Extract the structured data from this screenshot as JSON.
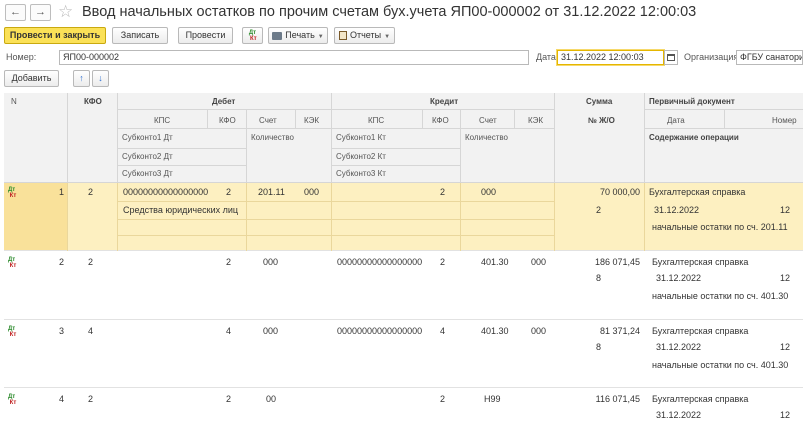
{
  "window": {
    "title": "Ввод начальных остатков по прочим счетам бух.учета ЯП00-000002 от 31.12.2022 12:00:03"
  },
  "toolbar": {
    "post_close": "Провести и закрыть",
    "save": "Записать",
    "post": "Провести",
    "print": "Печать",
    "reports": "Отчеты"
  },
  "form": {
    "number_label": "Номер:",
    "number_value": "ЯП00-000002",
    "date_label": "Дата:",
    "date_value": "31.12.2022 12:00:03",
    "org_label": "Организация:",
    "org_value": "ФГБУ санаторий"
  },
  "table_toolbar": {
    "add": "Добавить"
  },
  "columns": {
    "n": "N",
    "kfo": "КФО",
    "debit": "Дебет",
    "debit_kps": "КПС",
    "debit_kfo": "КФО",
    "debit_account": "Счет",
    "debit_kek": "КЭК",
    "debit_sub1": "Субконто1 Дт",
    "debit_sub2": "Субконто2 Дт",
    "debit_sub3": "Субконто3 Дт",
    "debit_qty": "Количество",
    "credit": "Кредит",
    "credit_kps": "КПС",
    "credit_kfo": "КФО",
    "credit_account": "Счет",
    "credit_kek": "КЭК",
    "credit_sub1": "Субконто1 Кт",
    "credit_sub2": "Субконто2 Кт",
    "credit_sub3": "Субконто3 Кт",
    "credit_qty": "Количество",
    "sum": "Сумма",
    "journal": "№ Ж/О",
    "doc": "Первичный документ",
    "doc_date": "Дата",
    "doc_num": "Номер",
    "doc_content": "Содержание операции"
  },
  "rows": [
    {
      "n": "1",
      "kfo": "2",
      "dt_kps": "00000000000000000",
      "dt_kfo": "2",
      "dt_account": "201.11",
      "dt_kek": "000",
      "dt_sub1": "Средства юридических лиц",
      "ct_kps": "",
      "ct_kfo": "2",
      "ct_account": "000",
      "ct_kek": "",
      "sum": "70 000,00",
      "journal": "2",
      "doc": "Бухгалтерская справка",
      "doc_date": "31.12.2022",
      "doc_num": "12",
      "content": "начальные остатки по сч. 201.11"
    },
    {
      "n": "2",
      "kfo": "2",
      "dt_kps": "",
      "dt_kfo": "2",
      "dt_account": "000",
      "dt_kek": "",
      "dt_sub1": "",
      "ct_kps": "00000000000000000",
      "ct_kfo": "2",
      "ct_account": "401.30",
      "ct_kek": "000",
      "sum": "186 071,45",
      "journal": "8",
      "doc": "Бухгалтерская справка",
      "doc_date": "31.12.2022",
      "doc_num": "12",
      "content": "начальные остатки по сч. 401.30"
    },
    {
      "n": "3",
      "kfo": "4",
      "dt_kps": "",
      "dt_kfo": "4",
      "dt_account": "000",
      "dt_kek": "",
      "dt_sub1": "",
      "ct_kps": "00000000000000000",
      "ct_kfo": "4",
      "ct_account": "401.30",
      "ct_kek": "000",
      "sum": "81 371,24",
      "journal": "8",
      "doc": "Бухгалтерская справка",
      "doc_date": "31.12.2022",
      "doc_num": "12",
      "content": "начальные остатки по сч. 401.30"
    },
    {
      "n": "4",
      "kfo": "2",
      "dt_kps": "",
      "dt_kfo": "2",
      "dt_account": "00",
      "dt_kek": "",
      "dt_sub1": "",
      "ct_kps": "",
      "ct_kfo": "2",
      "ct_account": "Н99",
      "ct_kek": "",
      "sum": "116 071,45",
      "journal": "",
      "doc": "Бухгалтерская справка",
      "doc_date": "31.12.2022",
      "doc_num": "12",
      "content": ""
    }
  ],
  "icons": {
    "back": "arrow-left-icon",
    "forward": "arrow-right-icon",
    "favorite": "star-icon",
    "dtkt": "dt-kt-icon",
    "print": "printer-icon",
    "reports": "report-icon",
    "calendar": "calendar-icon",
    "move_up": "arrow-up-icon",
    "move_down": "arrow-down-icon"
  },
  "colors": {
    "primary_button": "#fbe157",
    "selected_row": "#fdf0c1",
    "date_focus": "#e5b600",
    "move_arrows": "#2f6fd0"
  }
}
